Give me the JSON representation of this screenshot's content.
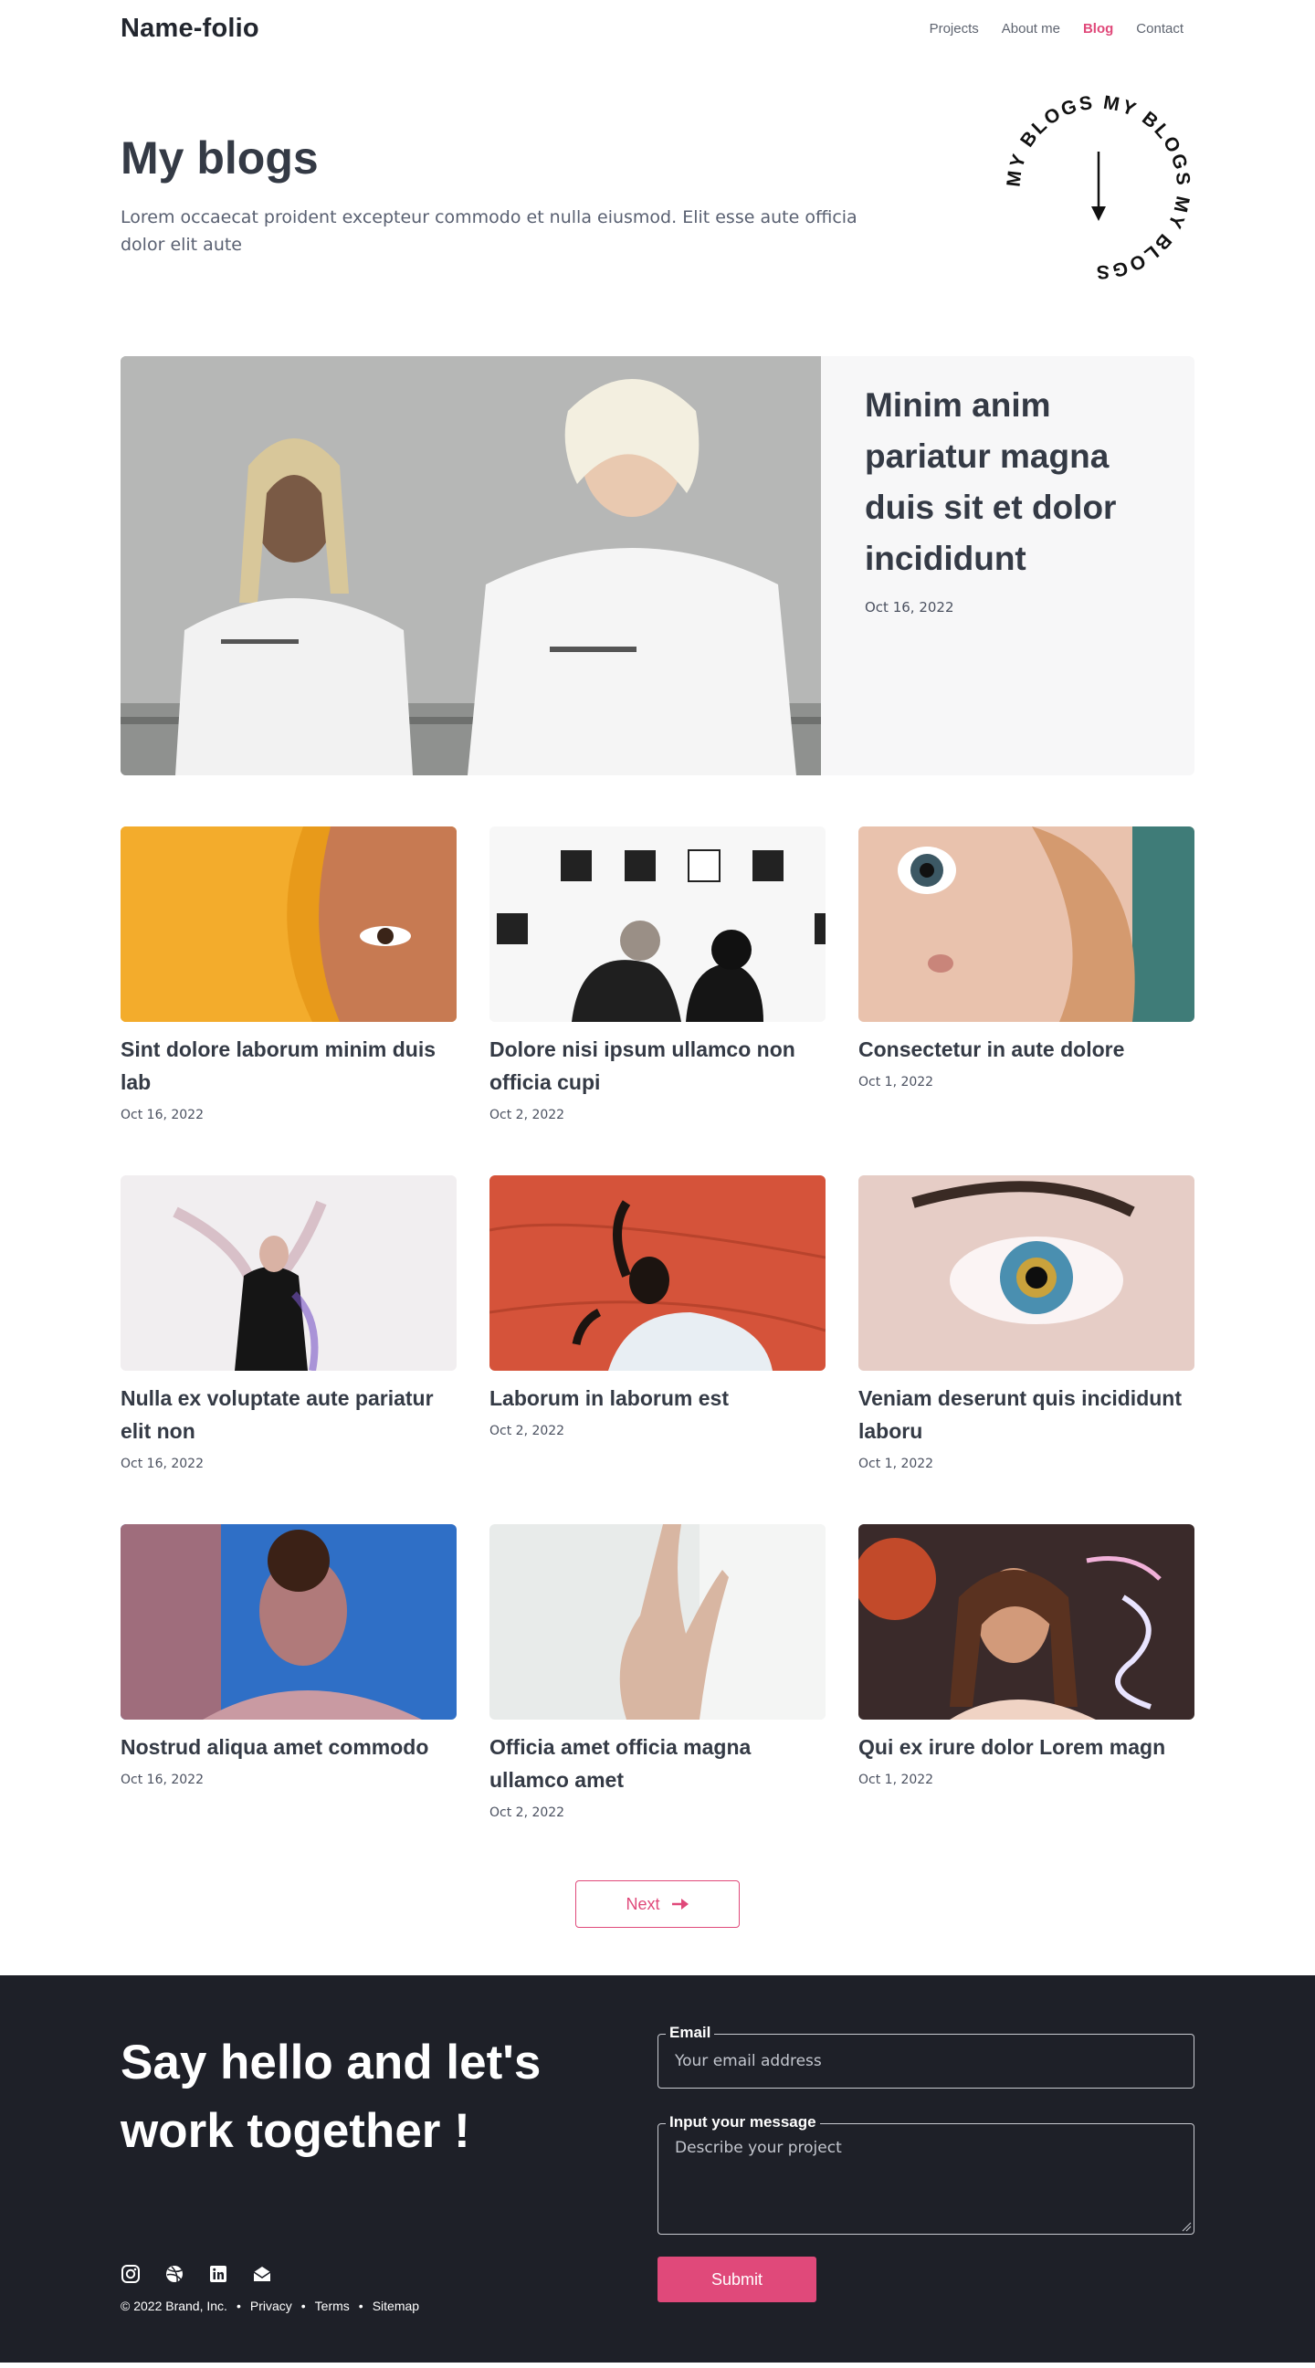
{
  "header": {
    "brand": "Name-folio",
    "nav": [
      {
        "label": "Projects",
        "active": false
      },
      {
        "label": "About me",
        "active": false
      },
      {
        "label": "Blog",
        "active": true
      },
      {
        "label": "Contact",
        "active": false
      }
    ]
  },
  "hero": {
    "title": "My blogs",
    "description": "Lorem occaecat proident excepteur commodo et nulla eiusmod. Elit esse aute officia dolor elit aute",
    "badge_text": "MY BLOGS  MY BLOGS  MY BLOGS  "
  },
  "featured": {
    "title": "Minim anim pariatur magna duis sit et dolor incididunt",
    "date": "Oct 16, 2022"
  },
  "posts": [
    {
      "title": "Sint dolore laborum minim duis lab",
      "date": "Oct 16, 2022"
    },
    {
      "title": "Dolore nisi ipsum ullamco non officia cupi",
      "date": "Oct 2, 2022"
    },
    {
      "title": "Consectetur in aute dolore",
      "date": "Oct 1, 2022"
    },
    {
      "title": "Nulla ex voluptate aute pariatur elit non",
      "date": "Oct 16, 2022"
    },
    {
      "title": "Laborum in laborum est",
      "date": "Oct 2, 2022"
    },
    {
      "title": "Veniam deserunt quis incididunt laboru",
      "date": "Oct 1, 2022"
    },
    {
      "title": "Nostrud aliqua amet commodo",
      "date": "Oct 16, 2022"
    },
    {
      "title": "Officia amet officia magna ullamco amet",
      "date": "Oct 2, 2022"
    },
    {
      "title": "Qui ex irure dolor Lorem magn",
      "date": "Oct 1, 2022"
    }
  ],
  "pager": {
    "next_label": "Next"
  },
  "footer": {
    "headline": "Say hello and let's work together !",
    "email_label": "Email",
    "email_placeholder": "Your email address",
    "message_label": "Input your message",
    "message_placeholder": "Describe your project",
    "submit_label": "Submit",
    "copyright": "© 2022 Brand, Inc.",
    "links": [
      "Privacy",
      "Terms",
      "Sitemap"
    ],
    "socials": [
      "instagram-icon",
      "dribbble-icon",
      "linkedin-icon",
      "mail-icon"
    ]
  },
  "colors": {
    "accent": "#e0497a",
    "footer_bg": "#1e2028",
    "text_dark": "#343a45"
  }
}
